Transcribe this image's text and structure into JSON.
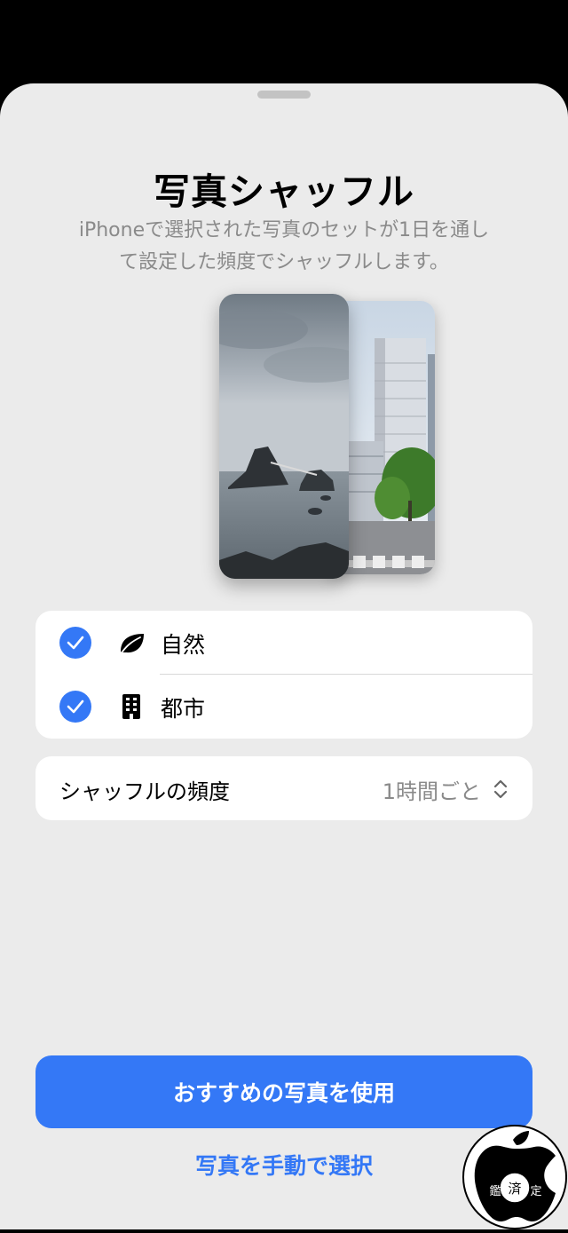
{
  "sheet": {
    "title": "写真シャッフル",
    "subtitle_line1": "iPhoneで選択された写真のセットが1日を通し",
    "subtitle_line2": "て設定した頻度でシャッフルします。"
  },
  "preview": {
    "front_photo": "nature-seascape-photo",
    "back_photo": "city-skyline-photo"
  },
  "categories": [
    {
      "label": "自然",
      "icon": "leaf-icon",
      "checked": true
    },
    {
      "label": "都市",
      "icon": "building-icon",
      "checked": true
    }
  ],
  "frequency": {
    "label": "シャッフルの頻度",
    "value": "1時間ごと",
    "icon": "chevron-up-down-icon"
  },
  "actions": {
    "primary_label": "おすすめの写真を使用",
    "secondary_label": "写真を手動で選択"
  },
  "watermark": {
    "text": "鑑済定"
  },
  "colors": {
    "accent": "#3478f6",
    "sheet_bg": "#ebebeb",
    "card_bg": "#ffffff",
    "secondary_text": "#8a8a8a"
  }
}
